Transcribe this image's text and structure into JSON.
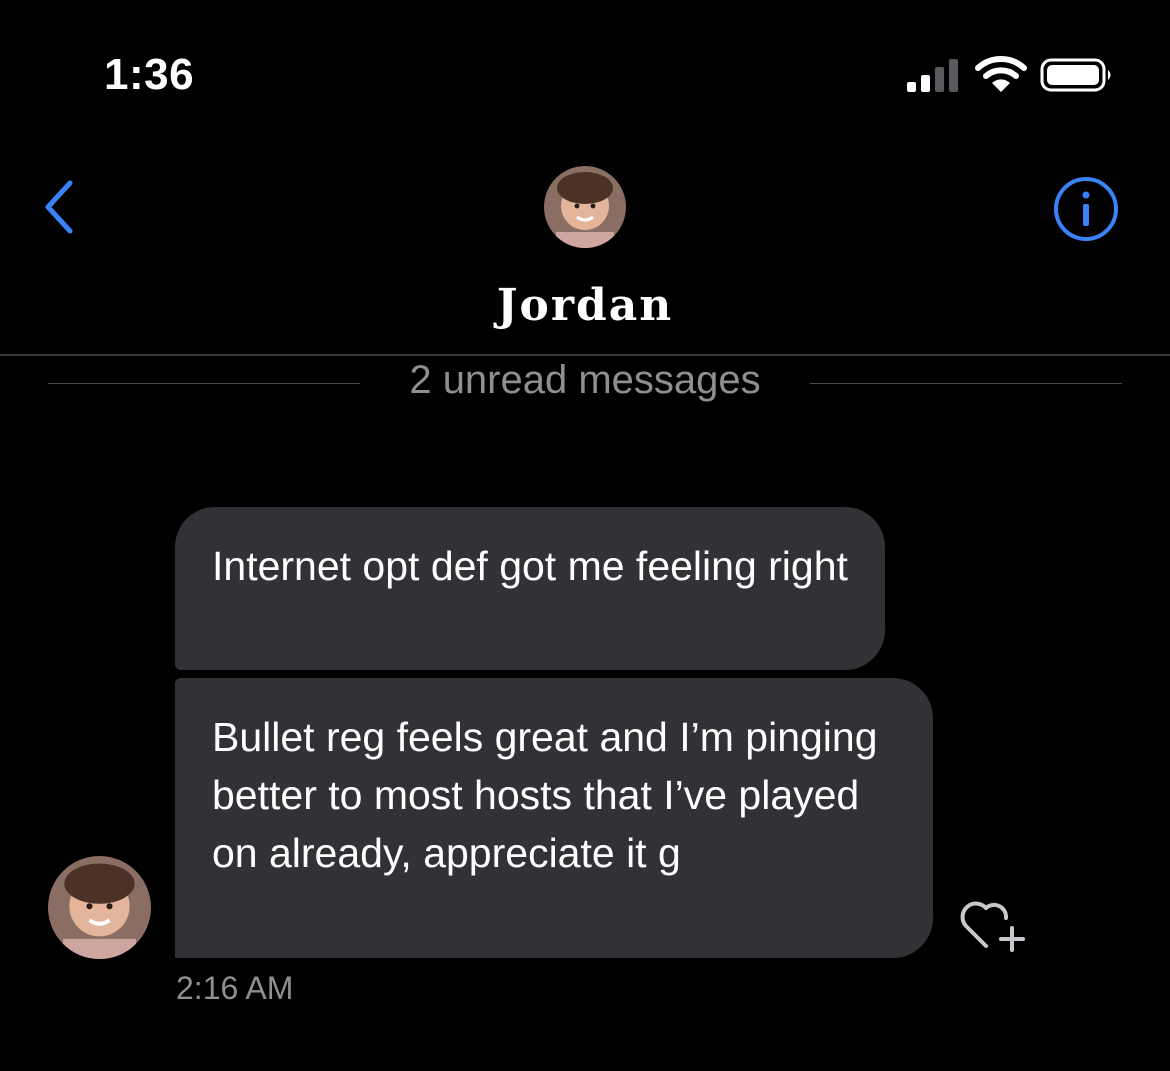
{
  "status_bar": {
    "time": "1:36"
  },
  "header": {
    "contact_name": "Jordan",
    "back_icon": "chevron-left-icon",
    "info_icon": "info-circle-icon"
  },
  "separator": {
    "unread_text": "2 unread messages"
  },
  "messages": [
    {
      "text": "Internet opt def got me feeling right"
    },
    {
      "text": "Bullet reg feels great and I’m pinging better to most hosts that I’ve played on already, appreciate it g"
    }
  ],
  "timestamp": "2:16 AM",
  "colors": {
    "background": "#000000",
    "accent": "#3a82f7",
    "bubble": "#303236",
    "secondary_text": "#8e8e93"
  }
}
